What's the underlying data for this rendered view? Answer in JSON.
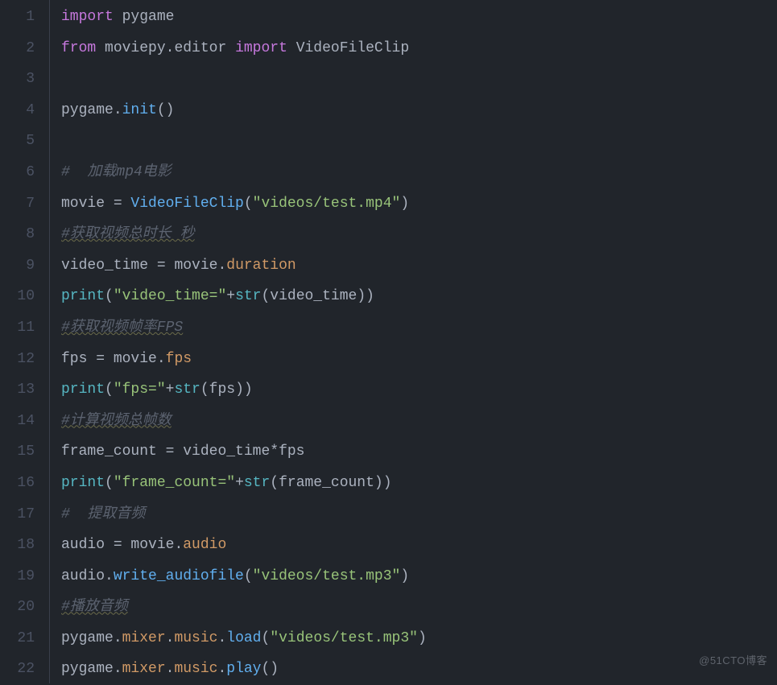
{
  "watermark": "@51CTO博客",
  "lines": [
    {
      "num": "1",
      "tokens": [
        {
          "cls": "tok-kw",
          "t": "import"
        },
        {
          "cls": "tok-op",
          "t": " "
        },
        {
          "cls": "tok-mod",
          "t": "pygame"
        }
      ]
    },
    {
      "num": "2",
      "tokens": [
        {
          "cls": "tok-kw",
          "t": "from"
        },
        {
          "cls": "tok-op",
          "t": " "
        },
        {
          "cls": "tok-mod",
          "t": "moviepy.editor"
        },
        {
          "cls": "tok-op",
          "t": " "
        },
        {
          "cls": "tok-kw",
          "t": "import"
        },
        {
          "cls": "tok-op",
          "t": " "
        },
        {
          "cls": "tok-mod",
          "t": "VideoFileClip"
        }
      ]
    },
    {
      "num": "3",
      "tokens": []
    },
    {
      "num": "4",
      "tokens": [
        {
          "cls": "tok-var",
          "t": "pygame"
        },
        {
          "cls": "tok-punc",
          "t": "."
        },
        {
          "cls": "tok-fn",
          "t": "init"
        },
        {
          "cls": "tok-punc",
          "t": "()"
        }
      ]
    },
    {
      "num": "5",
      "tokens": []
    },
    {
      "num": "6",
      "tokens": [
        {
          "cls": "tok-cmt",
          "t": "#  加载mp4电影"
        }
      ]
    },
    {
      "num": "7",
      "tokens": [
        {
          "cls": "tok-var",
          "t": "movie"
        },
        {
          "cls": "tok-op",
          "t": " = "
        },
        {
          "cls": "tok-fn",
          "t": "VideoFileClip"
        },
        {
          "cls": "tok-punc",
          "t": "("
        },
        {
          "cls": "tok-str",
          "t": "\"videos/test.mp4\""
        },
        {
          "cls": "tok-punc",
          "t": ")"
        }
      ]
    },
    {
      "num": "8",
      "tokens": [
        {
          "cls": "tok-cmt squiggle",
          "t": "#获取视频总时长 秒"
        }
      ]
    },
    {
      "num": "9",
      "tokens": [
        {
          "cls": "tok-var",
          "t": "video_time"
        },
        {
          "cls": "tok-op",
          "t": " = "
        },
        {
          "cls": "tok-var",
          "t": "movie"
        },
        {
          "cls": "tok-punc",
          "t": "."
        },
        {
          "cls": "tok-attr",
          "t": "duration"
        }
      ]
    },
    {
      "num": "10",
      "tokens": [
        {
          "cls": "tok-fnref",
          "t": "print"
        },
        {
          "cls": "tok-punc",
          "t": "("
        },
        {
          "cls": "tok-str",
          "t": "\"video_time=\""
        },
        {
          "cls": "tok-op",
          "t": "+"
        },
        {
          "cls": "tok-fnref",
          "t": "str"
        },
        {
          "cls": "tok-punc",
          "t": "("
        },
        {
          "cls": "tok-var",
          "t": "video_time"
        },
        {
          "cls": "tok-punc",
          "t": "))"
        }
      ]
    },
    {
      "num": "11",
      "tokens": [
        {
          "cls": "tok-cmt squiggle",
          "t": "#获取视频帧率FPS"
        }
      ]
    },
    {
      "num": "12",
      "tokens": [
        {
          "cls": "tok-var",
          "t": "fps"
        },
        {
          "cls": "tok-op",
          "t": " = "
        },
        {
          "cls": "tok-var",
          "t": "movie"
        },
        {
          "cls": "tok-punc",
          "t": "."
        },
        {
          "cls": "tok-attr",
          "t": "fps"
        }
      ]
    },
    {
      "num": "13",
      "tokens": [
        {
          "cls": "tok-fnref",
          "t": "print"
        },
        {
          "cls": "tok-punc",
          "t": "("
        },
        {
          "cls": "tok-str",
          "t": "\"fps=\""
        },
        {
          "cls": "tok-op",
          "t": "+"
        },
        {
          "cls": "tok-fnref",
          "t": "str"
        },
        {
          "cls": "tok-punc",
          "t": "("
        },
        {
          "cls": "tok-var",
          "t": "fps"
        },
        {
          "cls": "tok-punc",
          "t": "))"
        }
      ]
    },
    {
      "num": "14",
      "tokens": [
        {
          "cls": "tok-cmt squiggle",
          "t": "#计算视频总帧数"
        }
      ]
    },
    {
      "num": "15",
      "tokens": [
        {
          "cls": "tok-var",
          "t": "frame_count"
        },
        {
          "cls": "tok-op",
          "t": " = "
        },
        {
          "cls": "tok-var",
          "t": "video_time"
        },
        {
          "cls": "tok-op",
          "t": "*"
        },
        {
          "cls": "tok-var",
          "t": "fps"
        }
      ]
    },
    {
      "num": "16",
      "tokens": [
        {
          "cls": "tok-fnref",
          "t": "print"
        },
        {
          "cls": "tok-punc",
          "t": "("
        },
        {
          "cls": "tok-str",
          "t": "\"frame_count=\""
        },
        {
          "cls": "tok-op",
          "t": "+"
        },
        {
          "cls": "tok-fnref",
          "t": "str"
        },
        {
          "cls": "tok-punc",
          "t": "("
        },
        {
          "cls": "tok-var",
          "t": "frame_count"
        },
        {
          "cls": "tok-punc",
          "t": "))"
        }
      ]
    },
    {
      "num": "17",
      "tokens": [
        {
          "cls": "tok-cmt",
          "t": "#  提取音频"
        }
      ]
    },
    {
      "num": "18",
      "tokens": [
        {
          "cls": "tok-var",
          "t": "audio"
        },
        {
          "cls": "tok-op",
          "t": " = "
        },
        {
          "cls": "tok-var",
          "t": "movie"
        },
        {
          "cls": "tok-punc",
          "t": "."
        },
        {
          "cls": "tok-attr",
          "t": "audio"
        }
      ]
    },
    {
      "num": "19",
      "tokens": [
        {
          "cls": "tok-var",
          "t": "audio"
        },
        {
          "cls": "tok-punc",
          "t": "."
        },
        {
          "cls": "tok-fn",
          "t": "write_audiofile"
        },
        {
          "cls": "tok-punc",
          "t": "("
        },
        {
          "cls": "tok-str",
          "t": "\"videos/test.mp3\""
        },
        {
          "cls": "tok-punc",
          "t": ")"
        }
      ]
    },
    {
      "num": "20",
      "tokens": [
        {
          "cls": "tok-cmt squiggle",
          "t": "#播放音频"
        }
      ]
    },
    {
      "num": "21",
      "tokens": [
        {
          "cls": "tok-var",
          "t": "pygame"
        },
        {
          "cls": "tok-punc",
          "t": "."
        },
        {
          "cls": "tok-attr",
          "t": "mixer"
        },
        {
          "cls": "tok-punc",
          "t": "."
        },
        {
          "cls": "tok-attr",
          "t": "music"
        },
        {
          "cls": "tok-punc",
          "t": "."
        },
        {
          "cls": "tok-fn",
          "t": "load"
        },
        {
          "cls": "tok-punc",
          "t": "("
        },
        {
          "cls": "tok-str",
          "t": "\"videos/test.mp3\""
        },
        {
          "cls": "tok-punc",
          "t": ")"
        }
      ]
    },
    {
      "num": "22",
      "tokens": [
        {
          "cls": "tok-var",
          "t": "pygame"
        },
        {
          "cls": "tok-punc",
          "t": "."
        },
        {
          "cls": "tok-attr",
          "t": "mixer"
        },
        {
          "cls": "tok-punc",
          "t": "."
        },
        {
          "cls": "tok-attr",
          "t": "music"
        },
        {
          "cls": "tok-punc",
          "t": "."
        },
        {
          "cls": "tok-fn",
          "t": "play"
        },
        {
          "cls": "tok-punc",
          "t": "()"
        }
      ]
    }
  ]
}
